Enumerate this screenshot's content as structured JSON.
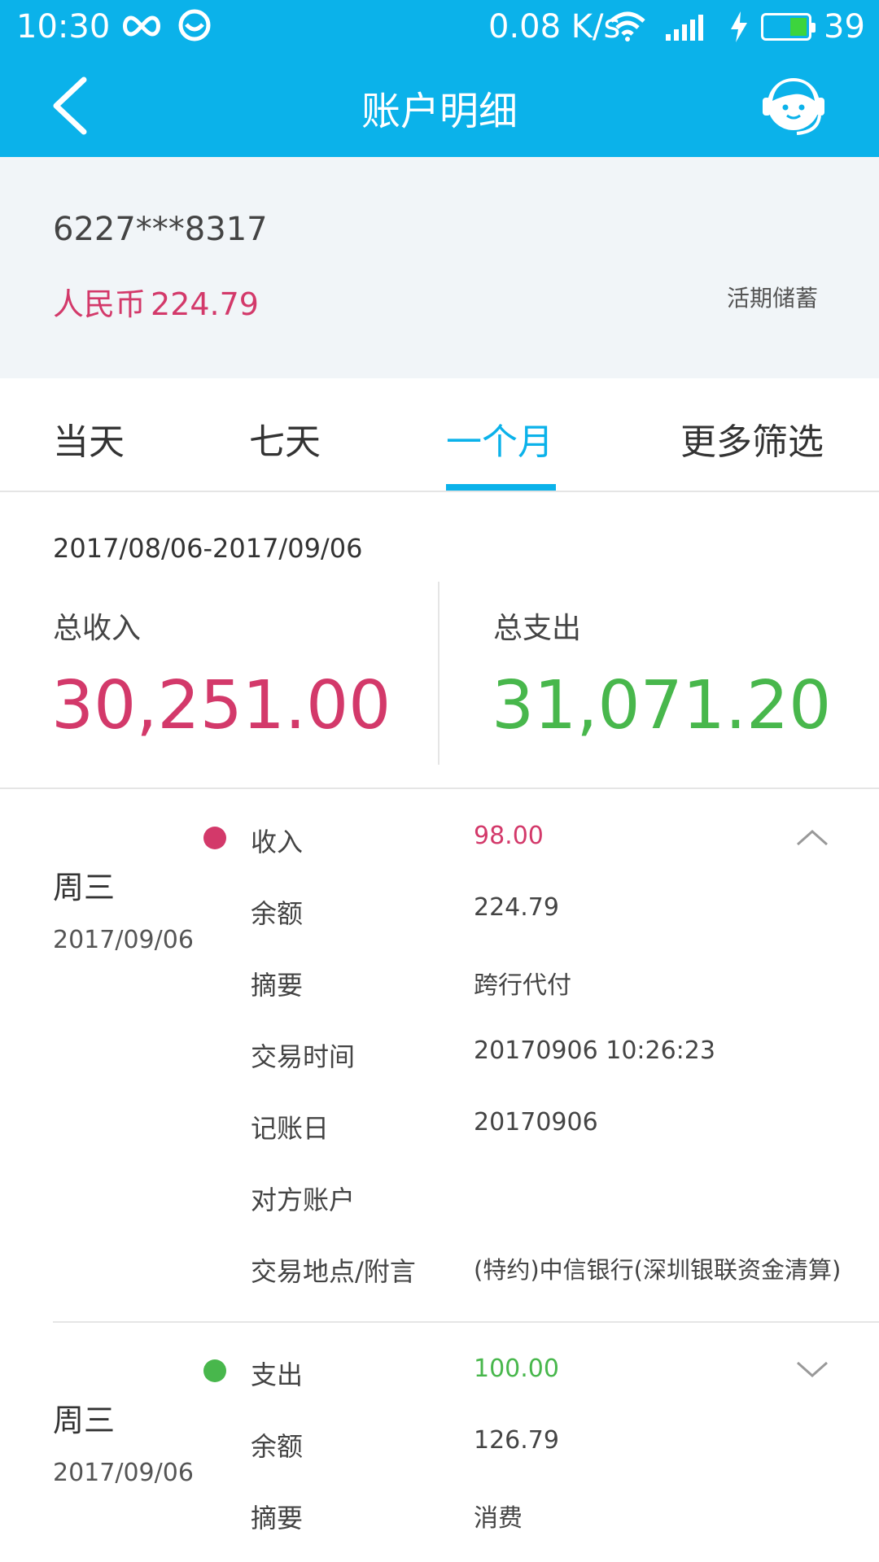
{
  "status_bar": {
    "time": "10:30",
    "speed": "0.08 K/s",
    "battery": "39"
  },
  "header": {
    "title": "账户明细"
  },
  "account": {
    "number": "6227***8317",
    "currency": "人民币",
    "balance": "224.79",
    "type": "活期储蓄"
  },
  "tabs": [
    {
      "label": "当天"
    },
    {
      "label": "七天"
    },
    {
      "label": "一个月",
      "active": true
    },
    {
      "label": "更多筛选"
    }
  ],
  "summary": {
    "date_range": "2017/08/06-2017/09/06",
    "income_label": "总收入",
    "income_value": "30,251.00",
    "expense_label": "总支出",
    "expense_value": "31,071.20"
  },
  "transactions": [
    {
      "weekday": "周三",
      "date": "2017/09/06",
      "type_label": "收入",
      "amount": "98.00",
      "kind": "income",
      "expanded": true,
      "fields": [
        {
          "label": "余额",
          "value": "224.79"
        },
        {
          "label": "摘要",
          "value": "跨行代付"
        },
        {
          "label": "交易时间",
          "value": "20170906 10:26:23"
        },
        {
          "label": "记账日",
          "value": "20170906"
        },
        {
          "label": "对方账户",
          "value": ""
        },
        {
          "label": "交易地点/附言",
          "value": "(特约)中信银行(深圳银联资金清算)"
        }
      ]
    },
    {
      "weekday": "周三",
      "date": "2017/09/06",
      "type_label": "支出",
      "amount": "100.00",
      "kind": "expense",
      "expanded": false,
      "fields": [
        {
          "label": "余额",
          "value": "126.79"
        },
        {
          "label": "摘要",
          "value": "消费"
        }
      ]
    }
  ],
  "colors": {
    "primary": "#0BB2EA",
    "income": "#D3396A",
    "expense": "#48B74C"
  }
}
